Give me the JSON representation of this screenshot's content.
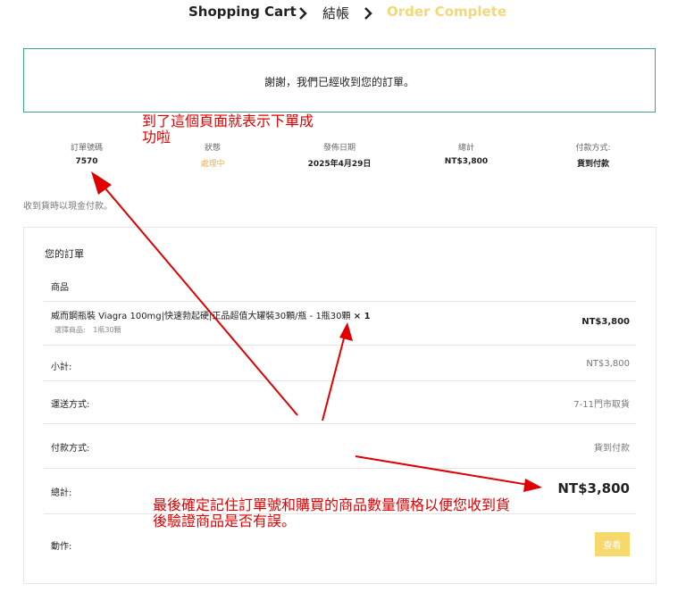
{
  "steps": [
    {
      "label": "Shopping Cart",
      "color": "#222222"
    },
    {
      "label": "結帳",
      "color": "#222222"
    },
    {
      "label": "Order Complete",
      "color": "#f3d87a"
    }
  ],
  "thanks_message": "謝謝，我們已經收到您的訂單。",
  "overview": {
    "order_number_label": "訂單號碼",
    "order_number": "7570",
    "status_label": "狀態",
    "status": "處理中",
    "status_color": "#f3b14a",
    "date_label": "發佈日期",
    "date": "2025年4月29日",
    "total_label": "總計",
    "total": "NT$3,800",
    "payment_label": "付款方式:",
    "payment": "貨到付款"
  },
  "payment_note": "收到貨時以現金付款。",
  "order": {
    "title": "您的訂單",
    "product_header": "商品",
    "item_name": "威而鋼瓶裝 Viagra 100mg|快速勃起硬|正品超值大罐裝30顆/瓶 - 1瓶30顆",
    "item_qty": "× 1",
    "item_meta_label": "選擇商品:",
    "item_meta_value": "1瓶30顆",
    "item_price": "NT$3,800",
    "subtotal_label": "小計:",
    "subtotal": "NT$3,800",
    "shipping_label": "運送方式:",
    "shipping": "7-11門市取貨",
    "payment_label": "付款方式:",
    "payment": "貨到付款",
    "total_label": "總計:",
    "total": "NT$3,800",
    "action_label": "動作:",
    "view_button": "查看"
  },
  "annotations": {
    "top_line1": "到了這個頁面就表示下單成",
    "top_line2": "功啦",
    "bottom_line1": "最後確定記住訂單號和購買的商品數量價格以便您收到貨",
    "bottom_line2": "後驗證商品是否有誤。",
    "color": "#e00000"
  }
}
